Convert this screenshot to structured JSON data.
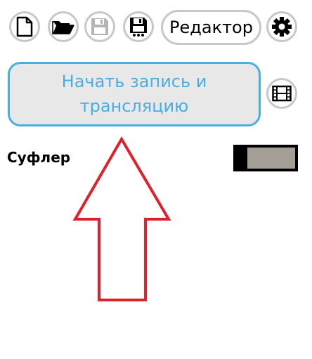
{
  "toolbar": {
    "new_icon": "document-icon",
    "open_icon": "folder-open-icon",
    "save_icon": "floppy-disk-icon",
    "save_as_icon": "floppy-disk-dots-icon",
    "editor_label": "Редактор",
    "settings_icon": "gear-icon"
  },
  "main": {
    "record_button_label": "Начать запись и трансляцию",
    "film_icon": "film-strip-icon"
  },
  "prompter": {
    "label": "Суфлер",
    "toggle_state": "off"
  },
  "colors": {
    "accent": "#4aaedf",
    "button_bg": "#e8e8e8",
    "border": "#c8c8c8",
    "annotation_arrow": "#e0202a",
    "toggle_track": "#a49f96"
  }
}
